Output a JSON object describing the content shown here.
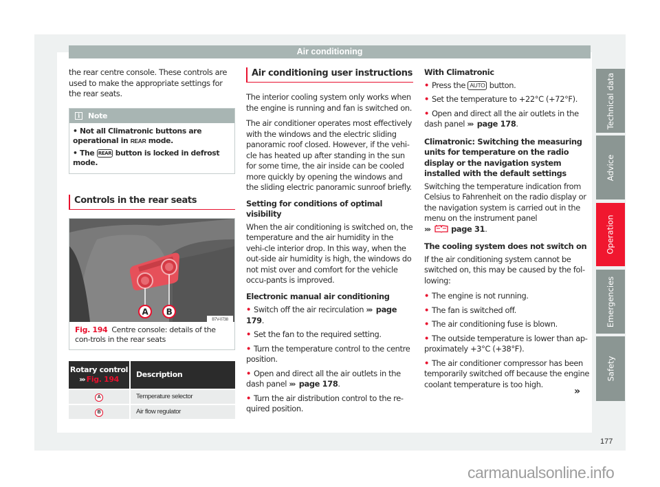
{
  "header": {
    "title": "Air conditioning"
  },
  "col1": {
    "intro": "the rear centre console. These controls are used to make the appropriate settings for the rear seats.",
    "note": {
      "title": "Note",
      "icon": "info-icon",
      "items": [
        {
          "pre": "Not all Climatronic buttons are operational in ",
          "badge": "REAR",
          "post": " mode."
        },
        {
          "pre": "The ",
          "badge": "REAR",
          "post": " button is locked in defrost mode."
        }
      ]
    },
    "section_title": "Controls in the rear seats",
    "figure": {
      "image_code": "B7V-0738",
      "label_a": "A",
      "label_b": "B",
      "number": "Fig. 194",
      "caption": "Centre console: details of the con-trols in the rear seats"
    },
    "table": {
      "header_col1_line1": "Rotary control",
      "header_col1_arrows": "›››",
      "header_col1_ref": "Fig. 194",
      "header_col2": "Description",
      "rows": [
        {
          "key": "A",
          "desc": "Temperature selector"
        },
        {
          "key": "B",
          "desc": "Air flow regulator"
        }
      ]
    }
  },
  "col2": {
    "section_title": "Air conditioning user instructions",
    "p1": "The interior cooling system only works when the engine is running and fan is switched on.",
    "p2": "The air conditioner operates most effectively with the windows and the electric sliding panoramic roof closed. However, if the vehi-cle has heated up after standing in the sun for some time, the air inside can be cooled more quickly by opening the windows and the sliding electric panoramic sunroof briefly.",
    "h_visibility": "Setting for conditions of optimal visibility",
    "p3": "When the air conditioning is switched on, the temperature and the air humidity in the vehi-cle interior drop. In this way, when the out-side air humidity is high, the windows do not mist over and comfort for the vehicle occu-pants is improved.",
    "h_manual": "Electronic manual air conditioning",
    "bullets": [
      {
        "text": "Switch off the air recirculation ",
        "ref": "page 179",
        "end": "."
      },
      {
        "text": "Set the fan to the required setting.",
        "ref": "",
        "end": ""
      },
      {
        "text": "Turn the temperature control to the centre position.",
        "ref": "",
        "end": ""
      },
      {
        "text": "Open and direct all the air outlets in the dash panel ",
        "ref": "page 178",
        "end": "."
      },
      {
        "text": "Turn the air distribution control to the re-quired position.",
        "ref": "",
        "end": ""
      }
    ]
  },
  "col3": {
    "h_climatronic": "With Climatronic",
    "b1_pre": "Press the ",
    "b1_button": "AUTO",
    "b1_post": " button.",
    "b2": "Set the temperature to +22°C (+72°F).",
    "b3_text": "Open and direct all the air outlets in the dash panel ",
    "b3_ref": "page 178",
    "h_units": "Climatronic: Switching the measuring units for temperature on the radio display or the navigation system installed with the default settings",
    "p_units": "Switching the temperature indication from Celsius to Fahrenheit on the radio display or the navigation system is carried out in the menu on the instrument panel",
    "p_units_ref": "page 31",
    "h_cooling": "The cooling system does not switch on",
    "p_cooling": "If the air conditioning system cannot be switched on, this may be caused by the fol-lowing:",
    "bullets": [
      "The engine is not running.",
      "The fan is switched off.",
      "The air conditioning fuse is blown.",
      "The outside temperature is lower than ap-proximately +3°C (+38°F).",
      "The air conditioner compressor has been temporarily switched off because the engine coolant temperature is too high."
    ],
    "continue_mark": "»"
  },
  "side_tabs": [
    {
      "label": "Technical data",
      "active": false
    },
    {
      "label": "Advice",
      "active": false
    },
    {
      "label": "Operation",
      "active": true
    },
    {
      "label": "Emergencies",
      "active": false
    },
    {
      "label": "Safety",
      "active": false
    }
  ],
  "page_number": "177",
  "watermark": "carmanualsonline.info",
  "colors": {
    "accent": "#e8102d",
    "header_bar": "#a8b5b3",
    "tab_inactive": "#8b9693",
    "tab_active": "#f0172f",
    "table_header": "#2b2b2b"
  }
}
